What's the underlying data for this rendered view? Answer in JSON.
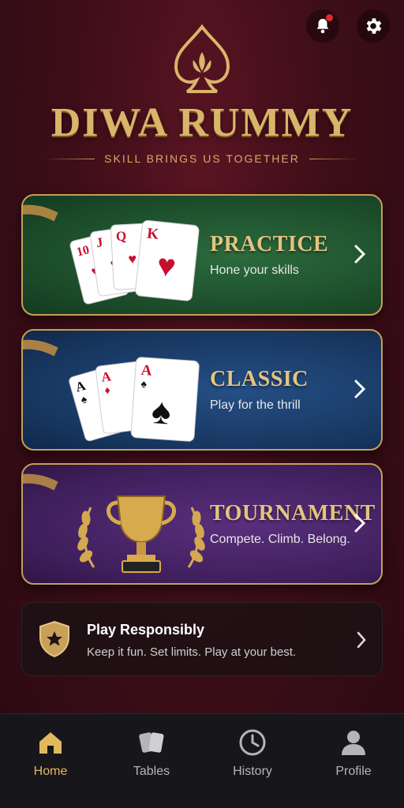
{
  "header": {
    "notifications_icon": "bell-icon",
    "settings_icon": "gear-icon",
    "has_notification": true
  },
  "brand": {
    "title": "DIWA RUMMY",
    "tagline": "SKILL BRINGS US TOGETHER"
  },
  "modes": [
    {
      "title": "PRACTICE",
      "subtitle": "Hone your skills",
      "art": "playing-cards-10-j-q-k-hearts"
    },
    {
      "title": "CLASSIC",
      "subtitle": "Play for the thrill",
      "art": "playing-cards-aces"
    },
    {
      "title": "TOURNAMENT",
      "subtitle": "Compete. Climb. Belong.",
      "art": "trophy-with-laurels"
    }
  ],
  "responsible": {
    "title": "Play Responsibly",
    "subtitle": "Keep it fun. Set limits. Play at your best.",
    "icon": "shield-star-icon"
  },
  "nav": {
    "active": "Home",
    "items": [
      {
        "label": "Home",
        "icon": "home-icon"
      },
      {
        "label": "Tables",
        "icon": "cards-icon"
      },
      {
        "label": "History",
        "icon": "clock-icon"
      },
      {
        "label": "Profile",
        "icon": "user-icon"
      }
    ]
  },
  "colors": {
    "accent_gold": "#d9b46a",
    "active_nav": "#e2b85f",
    "notif_dot": "#e02b2b"
  }
}
